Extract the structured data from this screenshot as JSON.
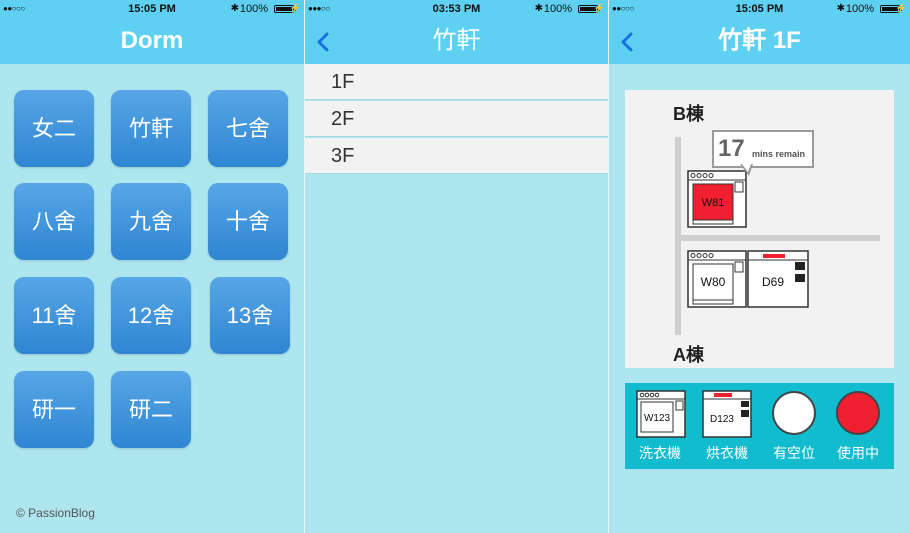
{
  "screens": {
    "dorm": {
      "status": {
        "signal": "●●○○○",
        "time": "15:05 PM",
        "battery": "100%"
      },
      "title": "Dorm",
      "buildings": [
        "女二",
        "竹軒",
        "七舍",
        "八舍",
        "九舍",
        "十舍",
        "11舍",
        "12舍",
        "13舍",
        "研一",
        "研二"
      ],
      "copyright": "© PassionBlog"
    },
    "floors": {
      "status": {
        "signal": "●●●○○",
        "time": "03:53 PM",
        "battery": "100%"
      },
      "title": "竹軒",
      "items": [
        "1F",
        "2F",
        "3F"
      ]
    },
    "map": {
      "status": {
        "signal": "●●○○○",
        "time": "15:05 PM",
        "battery": "100%"
      },
      "title": "竹軒 1F",
      "building_b": "B棟",
      "building_a": "A棟",
      "callout": {
        "minutes": "17",
        "text": "mins remain"
      },
      "machines": [
        {
          "id": "W81",
          "type": "washer",
          "status": "in-use"
        },
        {
          "id": "W80",
          "type": "washer",
          "status": "available"
        },
        {
          "id": "D69",
          "type": "dryer",
          "status": "available"
        }
      ],
      "legend": {
        "washer_id": "W123",
        "washer_label": "洗衣機",
        "dryer_id": "D123",
        "dryer_label": "烘衣機",
        "available_label": "有空位",
        "in_use_label": "使用中"
      }
    }
  },
  "colors": {
    "header": "#5ed0f2",
    "background": "#ade6ee",
    "tile": "#3a8fd8",
    "in_use": "#f02030",
    "legend_bg": "#10bccd"
  },
  "icons": [
    "back-chevron-icon",
    "bluetooth-icon",
    "battery-icon",
    "charging-bolt-icon"
  ]
}
